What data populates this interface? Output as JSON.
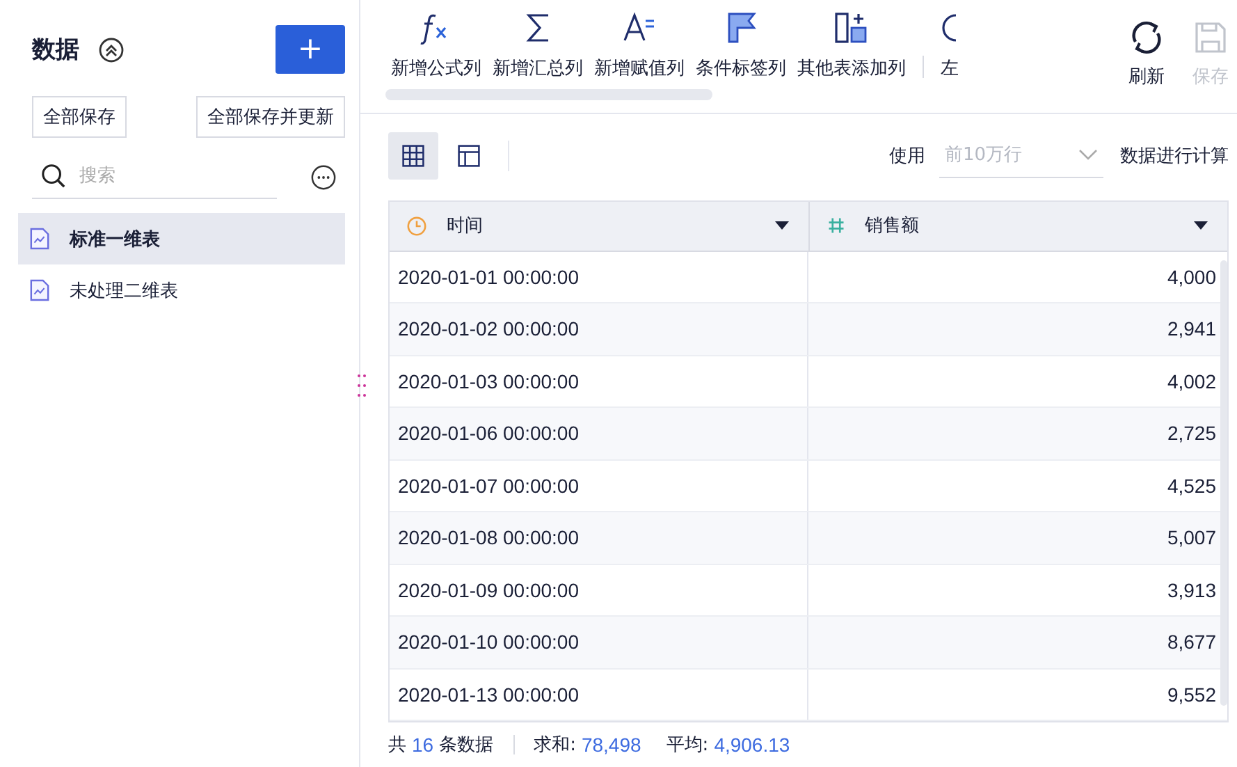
{
  "sidebar": {
    "title": "数据",
    "add_button": "+",
    "buttons": [
      "全部保存",
      "全部保存并更新"
    ],
    "search": {
      "placeholder": "搜索"
    },
    "items": [
      {
        "label": "标准一维表",
        "selected": true
      },
      {
        "label": "未处理二维表",
        "selected": false
      }
    ]
  },
  "toolbar": {
    "items": [
      {
        "kind": "formula",
        "label": "新增公式列"
      },
      {
        "kind": "sum",
        "label": "新增汇总列"
      },
      {
        "kind": "assign",
        "label": "新增赋值列"
      },
      {
        "kind": "flag",
        "label": "条件标签列"
      },
      {
        "kind": "add",
        "label": "其他表添加列"
      },
      {
        "kind": "partial",
        "label": "左"
      }
    ],
    "actions": [
      {
        "label": "刷新",
        "disabled": false
      },
      {
        "label": "保存",
        "disabled": true
      }
    ]
  },
  "options": {
    "views": [
      {
        "kind": "grid",
        "selected": true
      },
      {
        "kind": "layout",
        "selected": false
      }
    ],
    "use_label": "使用",
    "rows_select": {
      "placeholder": "前10万行"
    },
    "suffix": "数据进行计算"
  },
  "table": {
    "columns": [
      {
        "kind": "time",
        "label": "时间"
      },
      {
        "kind": "number",
        "label": "销售额"
      }
    ],
    "rows": [
      [
        "2020-01-01 00:00:00",
        "4,000"
      ],
      [
        "2020-01-02 00:00:00",
        "2,941"
      ],
      [
        "2020-01-03 00:00:00",
        "4,002"
      ],
      [
        "2020-01-06 00:00:00",
        "2,725"
      ],
      [
        "2020-01-07 00:00:00",
        "4,525"
      ],
      [
        "2020-01-08 00:00:00",
        "5,007"
      ],
      [
        "2020-01-09 00:00:00",
        "3,913"
      ],
      [
        "2020-01-10 00:00:00",
        "8,677"
      ],
      [
        "2020-01-13 00:00:00",
        "9,552"
      ]
    ]
  },
  "footer": {
    "count_prefix": "共",
    "count": "16",
    "count_suffix": "条数据",
    "sum_label": "求和:",
    "sum": "78,498",
    "avg_label": "平均:",
    "avg": "4,906.13"
  }
}
